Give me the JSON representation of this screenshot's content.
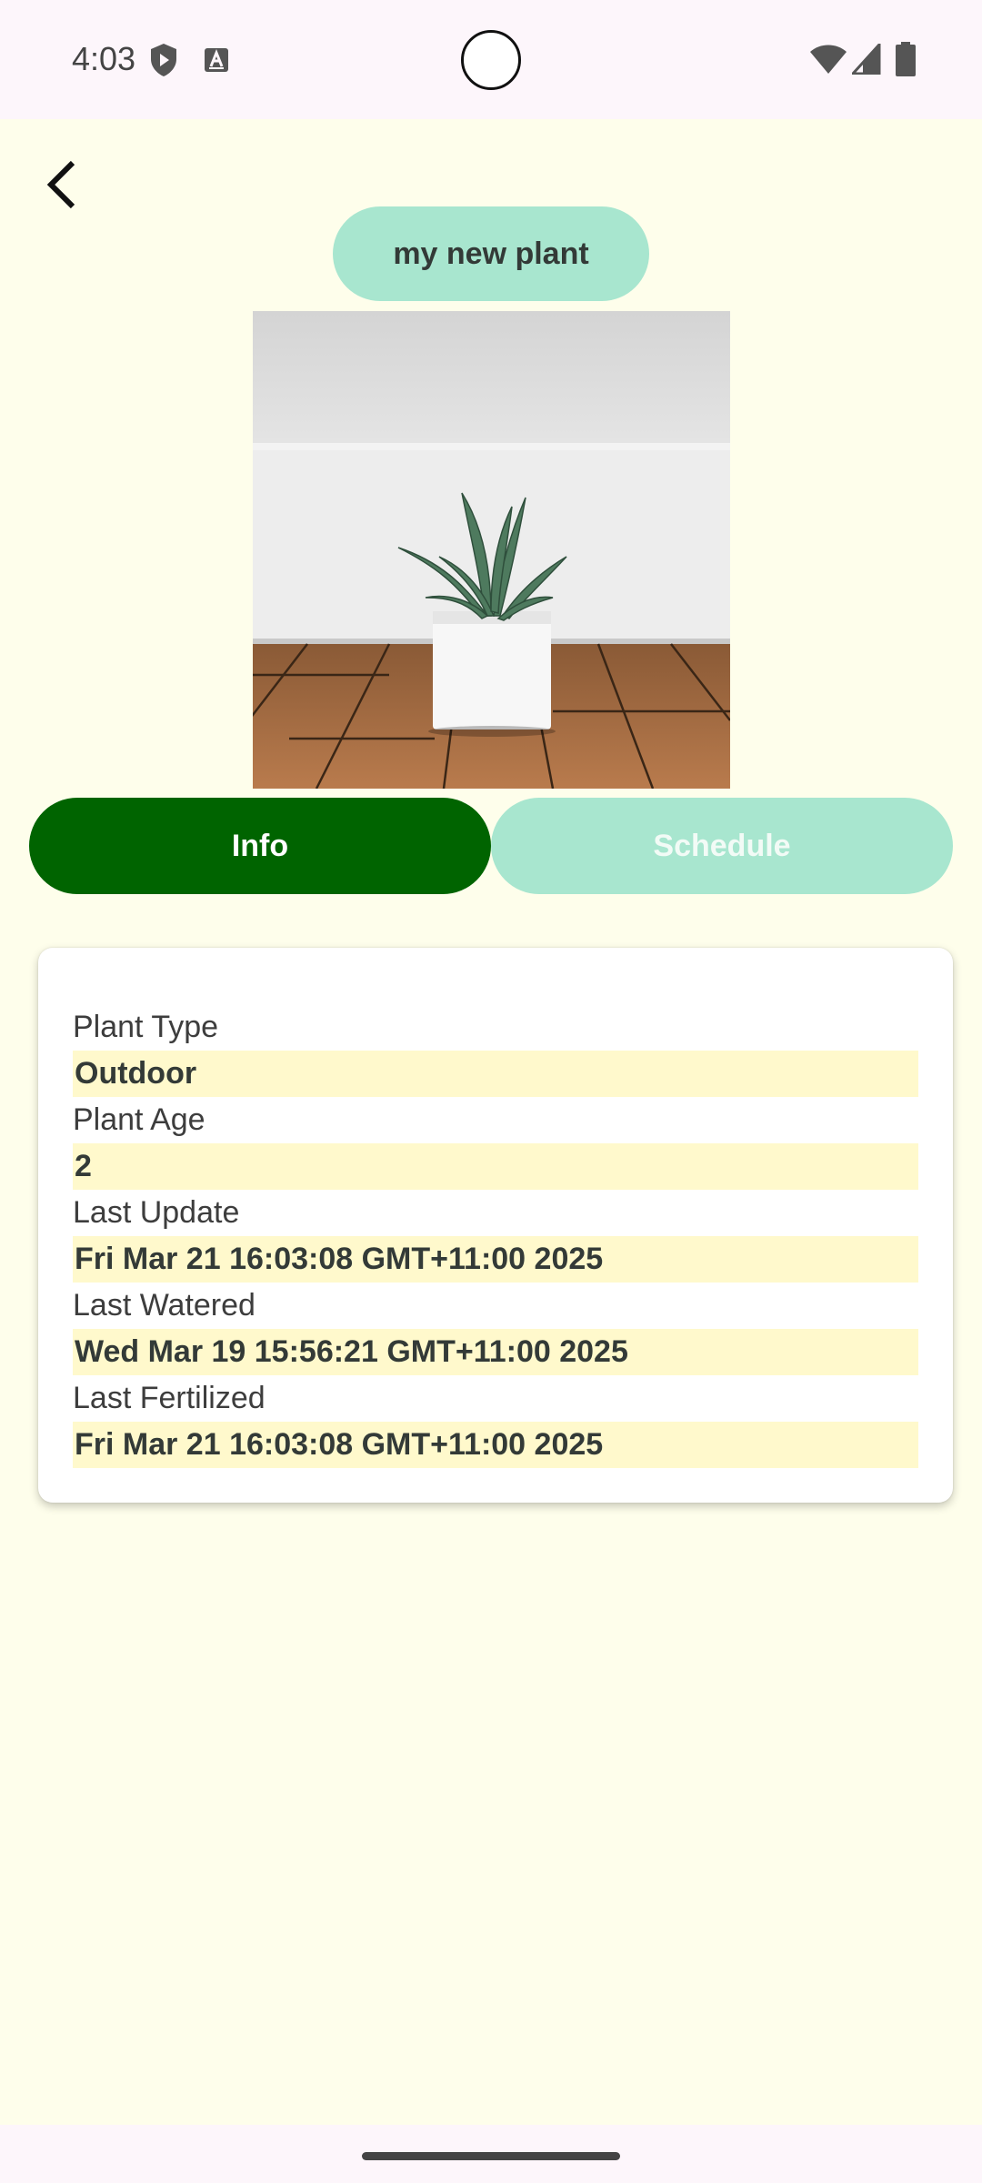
{
  "status_bar": {
    "time": "4:03",
    "icons": [
      "play-protect-icon",
      "keyboard-a-icon",
      "wifi-icon",
      "signal-icon",
      "battery-icon"
    ]
  },
  "header": {
    "back_icon": "chevron-left-icon",
    "title": "my new plant"
  },
  "plant_image": {
    "description_icon": "plant-photo"
  },
  "tabs": [
    {
      "label": "Info",
      "active": true
    },
    {
      "label": "Schedule",
      "active": false
    }
  ],
  "info": {
    "fields": [
      {
        "label": "Plant Type",
        "value": "Outdoor"
      },
      {
        "label": "Plant Age",
        "value": "2"
      },
      {
        "label": "Last Update",
        "value": "Fri Mar 21 16:03:08 GMT+11:00 2025"
      },
      {
        "label": "Last Watered",
        "value": "Wed Mar 19 15:56:21 GMT+11:00 2025"
      },
      {
        "label": "Last Fertilized",
        "value": "Fri Mar 21 16:03:08 GMT+11:00 2025"
      }
    ]
  },
  "colors": {
    "background": "#FEFEEB",
    "accent_green": "#006400",
    "mint": "#A8E6CF",
    "value_highlight": "#FFF9CC"
  }
}
